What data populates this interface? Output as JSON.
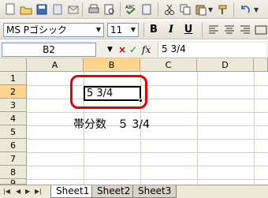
{
  "toolbar": {
    "font_name": "MS Pゴシック",
    "font_size": "11",
    "bold_label": "B",
    "italic_label": "I",
    "underline_label": "U"
  },
  "formula_bar": {
    "name_box": "B2",
    "cancel_symbol": "×",
    "enter_symbol": "✓",
    "fx_label": "fx",
    "content": "5 3/4"
  },
  "columns": [
    "A",
    "B",
    "C",
    "D"
  ],
  "rows": [
    "1",
    "2",
    "3",
    "4",
    "5",
    "6",
    "7",
    "8",
    "9"
  ],
  "cells": {
    "B2": "5 3/4",
    "B4": "帯分数　５ 3/4"
  },
  "sheet_tabs": [
    "Sheet1",
    "Sheet2",
    "Sheet3"
  ],
  "colors": {
    "highlight": "#e60000",
    "selected_header": "#ffd58d"
  }
}
